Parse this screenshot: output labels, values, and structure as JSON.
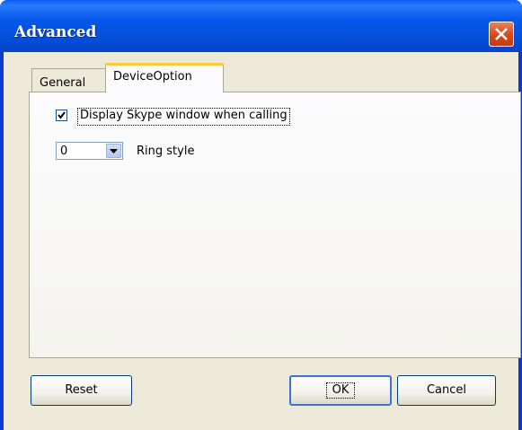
{
  "window": {
    "title": "Advanced"
  },
  "tabs": [
    {
      "label": "General",
      "selected": false
    },
    {
      "label": "DeviceOption",
      "selected": true
    }
  ],
  "device_option": {
    "display_window_checkbox": {
      "label": "Display Skype window when calling",
      "checked": true
    },
    "ring_style": {
      "selected_value": "0",
      "label": "Ring style"
    }
  },
  "buttons": {
    "reset": "Reset",
    "ok": "OK",
    "cancel": "Cancel"
  },
  "icons": {
    "close": "close-icon",
    "dropdown": "chevron-down-icon",
    "check": "checkmark-icon"
  },
  "colors": {
    "titlebar": "#0a5ef7",
    "close_button": "#d2491c",
    "dialog_background": "#ece9d8",
    "tab_highlight": "#ffc83c"
  }
}
